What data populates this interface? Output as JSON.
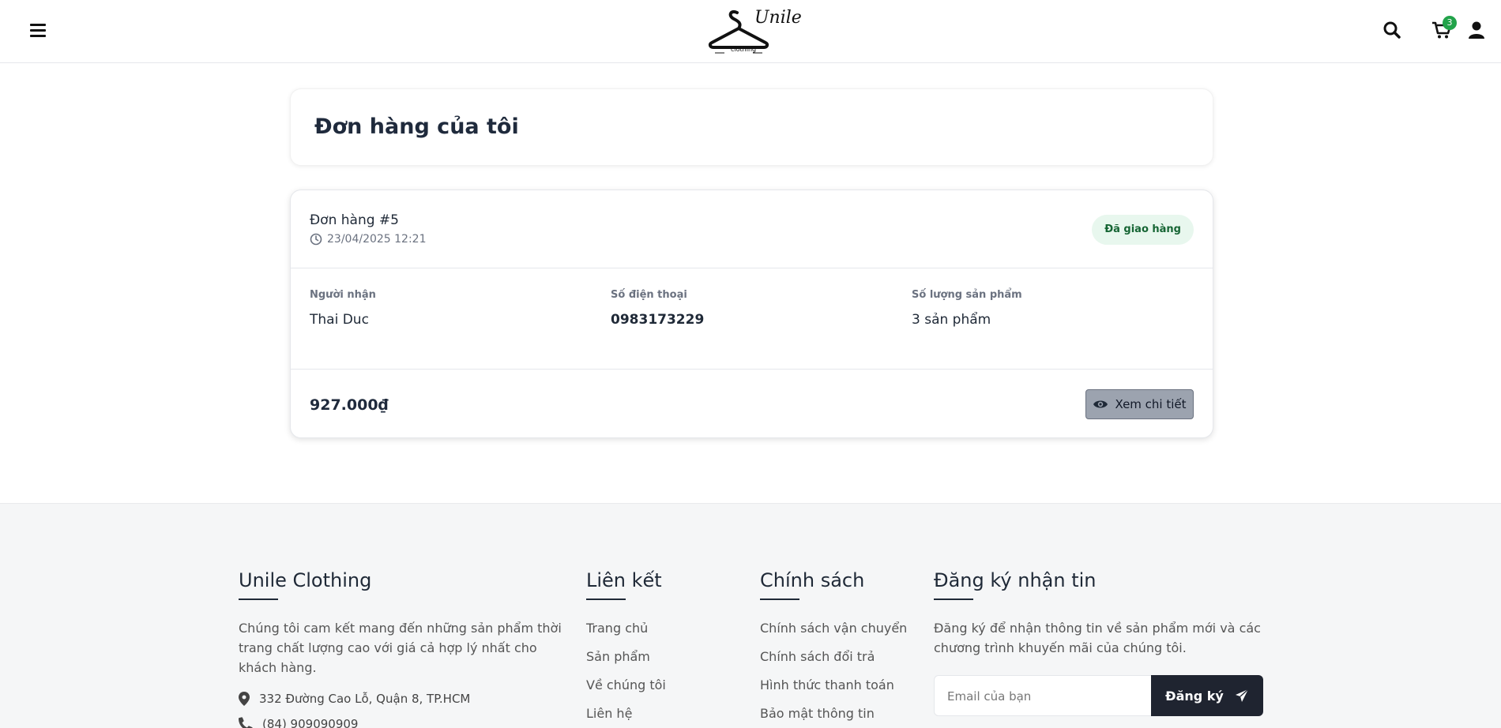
{
  "header": {
    "brand_script": "Unile",
    "brand_sub": "clothing",
    "cart_count": "3"
  },
  "page": {
    "title": "Đơn hàng của tôi"
  },
  "order": {
    "id_label": "Đơn hàng #5",
    "date": "23/04/2025 12:21",
    "status": "Đã giao hàng",
    "status_color": "#166534",
    "recipient_label": "Người nhận",
    "recipient": "Thai Duc",
    "phone_label": "Số điện thoại",
    "phone": "0983173229",
    "qty_label": "Số lượng sản phẩm",
    "qty": "3 sản phẩm",
    "total": "927.000₫",
    "detail_button": "Xem chi tiết"
  },
  "footer": {
    "about": {
      "title": "Unile Clothing",
      "text": "Chúng tôi cam kết mang đến những sản phẩm thời trang chất lượng cao với giá cả hợp lý nhất cho khách hàng.",
      "address": "332 Đường Cao Lỗ, Quận 8, TP.HCM",
      "phone": "(84) 909090909"
    },
    "links": {
      "title": "Liên kết",
      "items": [
        "Trang chủ",
        "Sản phẩm",
        "Về chúng tôi",
        "Liên hệ"
      ]
    },
    "policy": {
      "title": "Chính sách",
      "items": [
        "Chính sách vận chuyển",
        "Chính sách đổi trả",
        "Hình thức thanh toán",
        "Bảo mật thông tin"
      ]
    },
    "newsletter": {
      "title": "Đăng ký nhận tin",
      "text": "Đăng ký để nhận thông tin về sản phẩm mới và các chương trình khuyến mãi của chúng tôi.",
      "placeholder": "Email của bạn",
      "button": "Đăng ký"
    }
  },
  "icons": {
    "menu": "menu-icon",
    "search": "search-icon",
    "cart": "cart-icon",
    "user": "user-icon",
    "clock": "clock-icon",
    "eye": "eye-icon",
    "location": "location-icon",
    "phone": "phone-icon",
    "send": "send-icon"
  }
}
